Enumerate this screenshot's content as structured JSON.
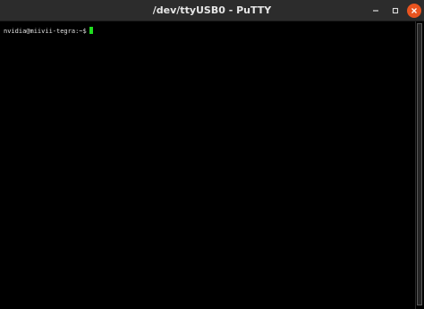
{
  "window": {
    "title": "/dev/ttyUSB0 - PuTTY",
    "controls": {
      "minimize_icon": "minimize-icon",
      "maximize_icon": "maximize-icon",
      "close_icon": "close-icon"
    },
    "close_color": "#e9541f"
  },
  "terminal": {
    "prompt": "nvidia@miivii-tegra:~$",
    "cursor_color": "#1fdc1f",
    "background": "#000000"
  }
}
